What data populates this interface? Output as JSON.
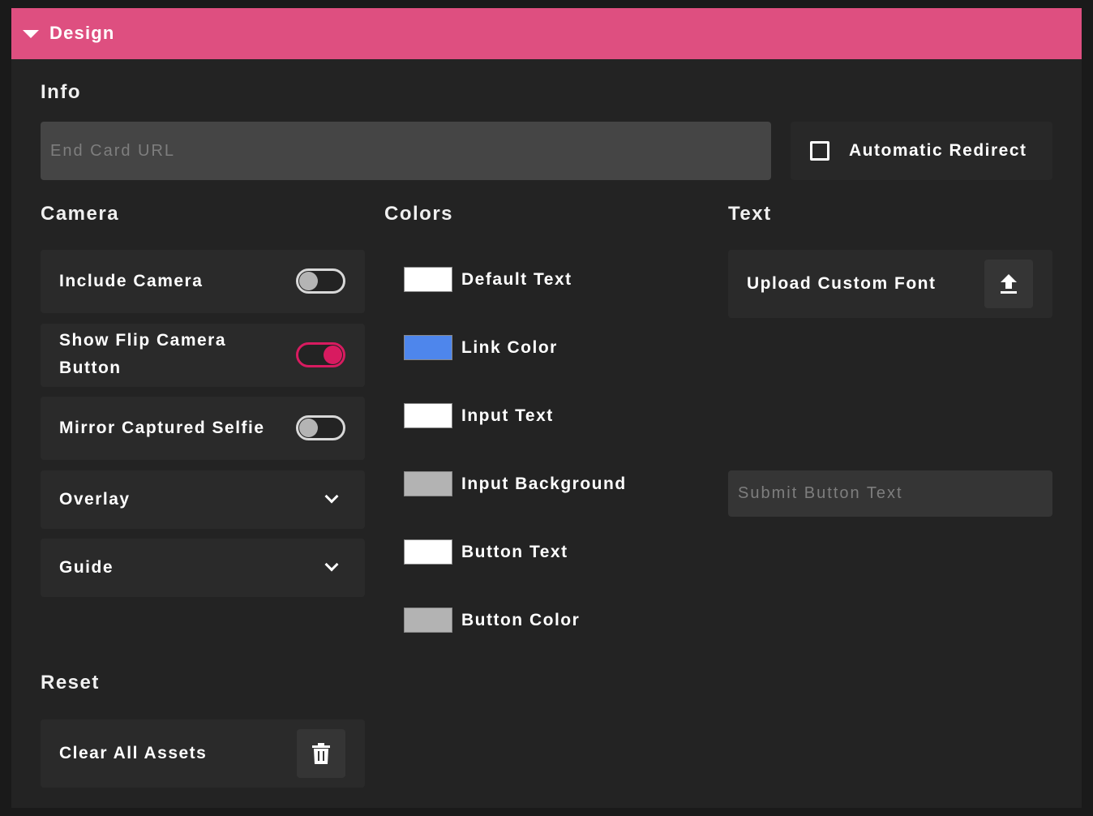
{
  "header": {
    "title": "Design",
    "caret_icon": "caret-down-icon"
  },
  "info": {
    "title": "Info",
    "end_card_placeholder": "End Card URL",
    "end_card_value": "",
    "auto_redirect_label": "Automatic Redirect",
    "auto_redirect_checked": false
  },
  "camera": {
    "title": "Camera",
    "include_camera": {
      "label": "Include Camera",
      "on": false
    },
    "flip_camera": {
      "label": "Show Flip Camera Button",
      "on": true
    },
    "mirror_selfie": {
      "label": "Mirror Captured Selfie",
      "on": false
    },
    "overlay_label": "Overlay",
    "guide_label": "Guide"
  },
  "colors": {
    "title": "Colors",
    "items": [
      {
        "label": "Default Text",
        "color": "#ffffff"
      },
      {
        "label": "Link Color",
        "color": "#4e86ec"
      },
      {
        "label": "Input Text",
        "color": "#ffffff"
      },
      {
        "label": "Input Background",
        "color": "#b3b3b3"
      },
      {
        "label": "Button Text",
        "color": "#ffffff"
      },
      {
        "label": "Button Color",
        "color": "#b3b3b3"
      }
    ]
  },
  "text": {
    "title": "Text",
    "upload_font_label": "Upload Custom Font",
    "submit_placeholder": "Submit Button Text",
    "submit_value": ""
  },
  "reset": {
    "title": "Reset",
    "clear_label": "Clear All Assets"
  },
  "theme": {
    "accent": "#de4f80",
    "toggle_on": "#d81b60",
    "panel_bg": "#232323",
    "card_bg": "#2a2a2a",
    "input_bg": "#454545"
  }
}
